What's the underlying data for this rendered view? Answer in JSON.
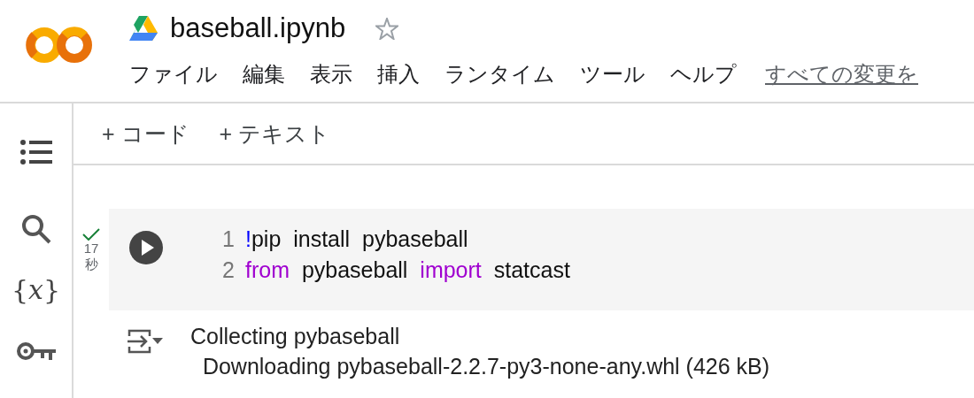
{
  "notebook": {
    "title": "baseball.ipynb",
    "starred": false
  },
  "menu": [
    {
      "label": "ファイル"
    },
    {
      "label": "編集"
    },
    {
      "label": "表示"
    },
    {
      "label": "挿入"
    },
    {
      "label": "ランタイム"
    },
    {
      "label": "ツール"
    },
    {
      "label": "ヘルプ"
    }
  ],
  "save_status": "すべての変更を",
  "sidebar": {
    "variables_glyph": "{𝑥}"
  },
  "toolbar": [
    {
      "label": "+ コード"
    },
    {
      "label": "+ テキスト"
    }
  ],
  "cell": {
    "succeeded": true,
    "time": "17",
    "time_unit": "秒",
    "lines": [
      {
        "number": "1",
        "tokens": [
          {
            "kind": "shell",
            "text": "!"
          },
          {
            "kind": "plain",
            "text": "pip  install  pybaseball"
          }
        ]
      },
      {
        "number": "2",
        "tokens": [
          {
            "kind": "keyword",
            "text": "from"
          },
          {
            "kind": "plain",
            "text": "  pybaseball  "
          },
          {
            "kind": "keyword",
            "text": "import"
          },
          {
            "kind": "plain",
            "text": "  statcast"
          }
        ]
      }
    ],
    "output": [
      "Collecting pybaseball",
      "  Downloading pybaseball-2.2.7-py3-none-any.whl (426 kB)"
    ]
  }
}
